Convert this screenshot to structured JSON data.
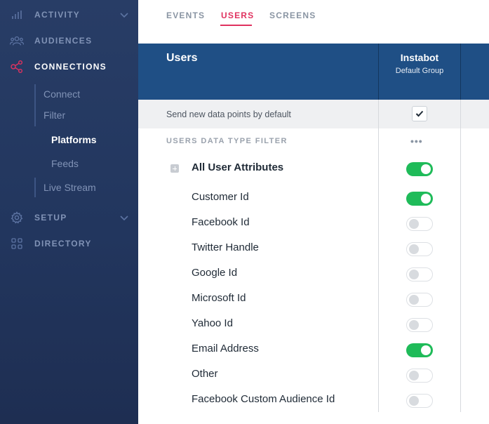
{
  "sidebar": {
    "items": [
      {
        "label": "ACTIVITY",
        "icon": "bar-chart-icon",
        "active": false
      },
      {
        "label": "AUDIENCES",
        "icon": "users-icon",
        "active": false
      },
      {
        "label": "CONNECTIONS",
        "icon": "connections-icon",
        "active": true
      },
      {
        "label": "SETUP",
        "icon": "gear-icon",
        "active": false
      },
      {
        "label": "DIRECTORY",
        "icon": "grid-icon",
        "active": false
      }
    ],
    "connections_sub": {
      "connect": "Connect",
      "filter": "Filter",
      "platforms": "Platforms",
      "feeds": "Feeds",
      "live_stream": "Live Stream"
    }
  },
  "tabs": [
    {
      "label": "EVENTS",
      "active": false
    },
    {
      "label": "USERS",
      "active": true
    },
    {
      "label": "SCREENS",
      "active": false
    }
  ],
  "table": {
    "title": "Users",
    "column_title": "Instabot",
    "column_subtitle": "Default Group",
    "send_default_label": "Send new data points by default",
    "send_default_checked": true,
    "filter_title": "USERS DATA TYPE FILTER",
    "more": "•••",
    "all_attributes": {
      "label": "All User Attributes",
      "enabled": true
    },
    "attributes": [
      {
        "label": "Customer Id",
        "enabled": true
      },
      {
        "label": "Facebook Id",
        "enabled": false
      },
      {
        "label": "Twitter Handle",
        "enabled": false
      },
      {
        "label": "Google Id",
        "enabled": false
      },
      {
        "label": "Microsoft Id",
        "enabled": false
      },
      {
        "label": "Yahoo Id",
        "enabled": false
      },
      {
        "label": "Email Address",
        "enabled": true
      },
      {
        "label": "Other",
        "enabled": false
      },
      {
        "label": "Facebook Custom Audience Id",
        "enabled": false
      }
    ]
  },
  "colors": {
    "accent": "#e0325f",
    "toggle_on": "#1fbb59",
    "header_bg": "#1f4f85",
    "sidebar_bg": "#253a63"
  }
}
